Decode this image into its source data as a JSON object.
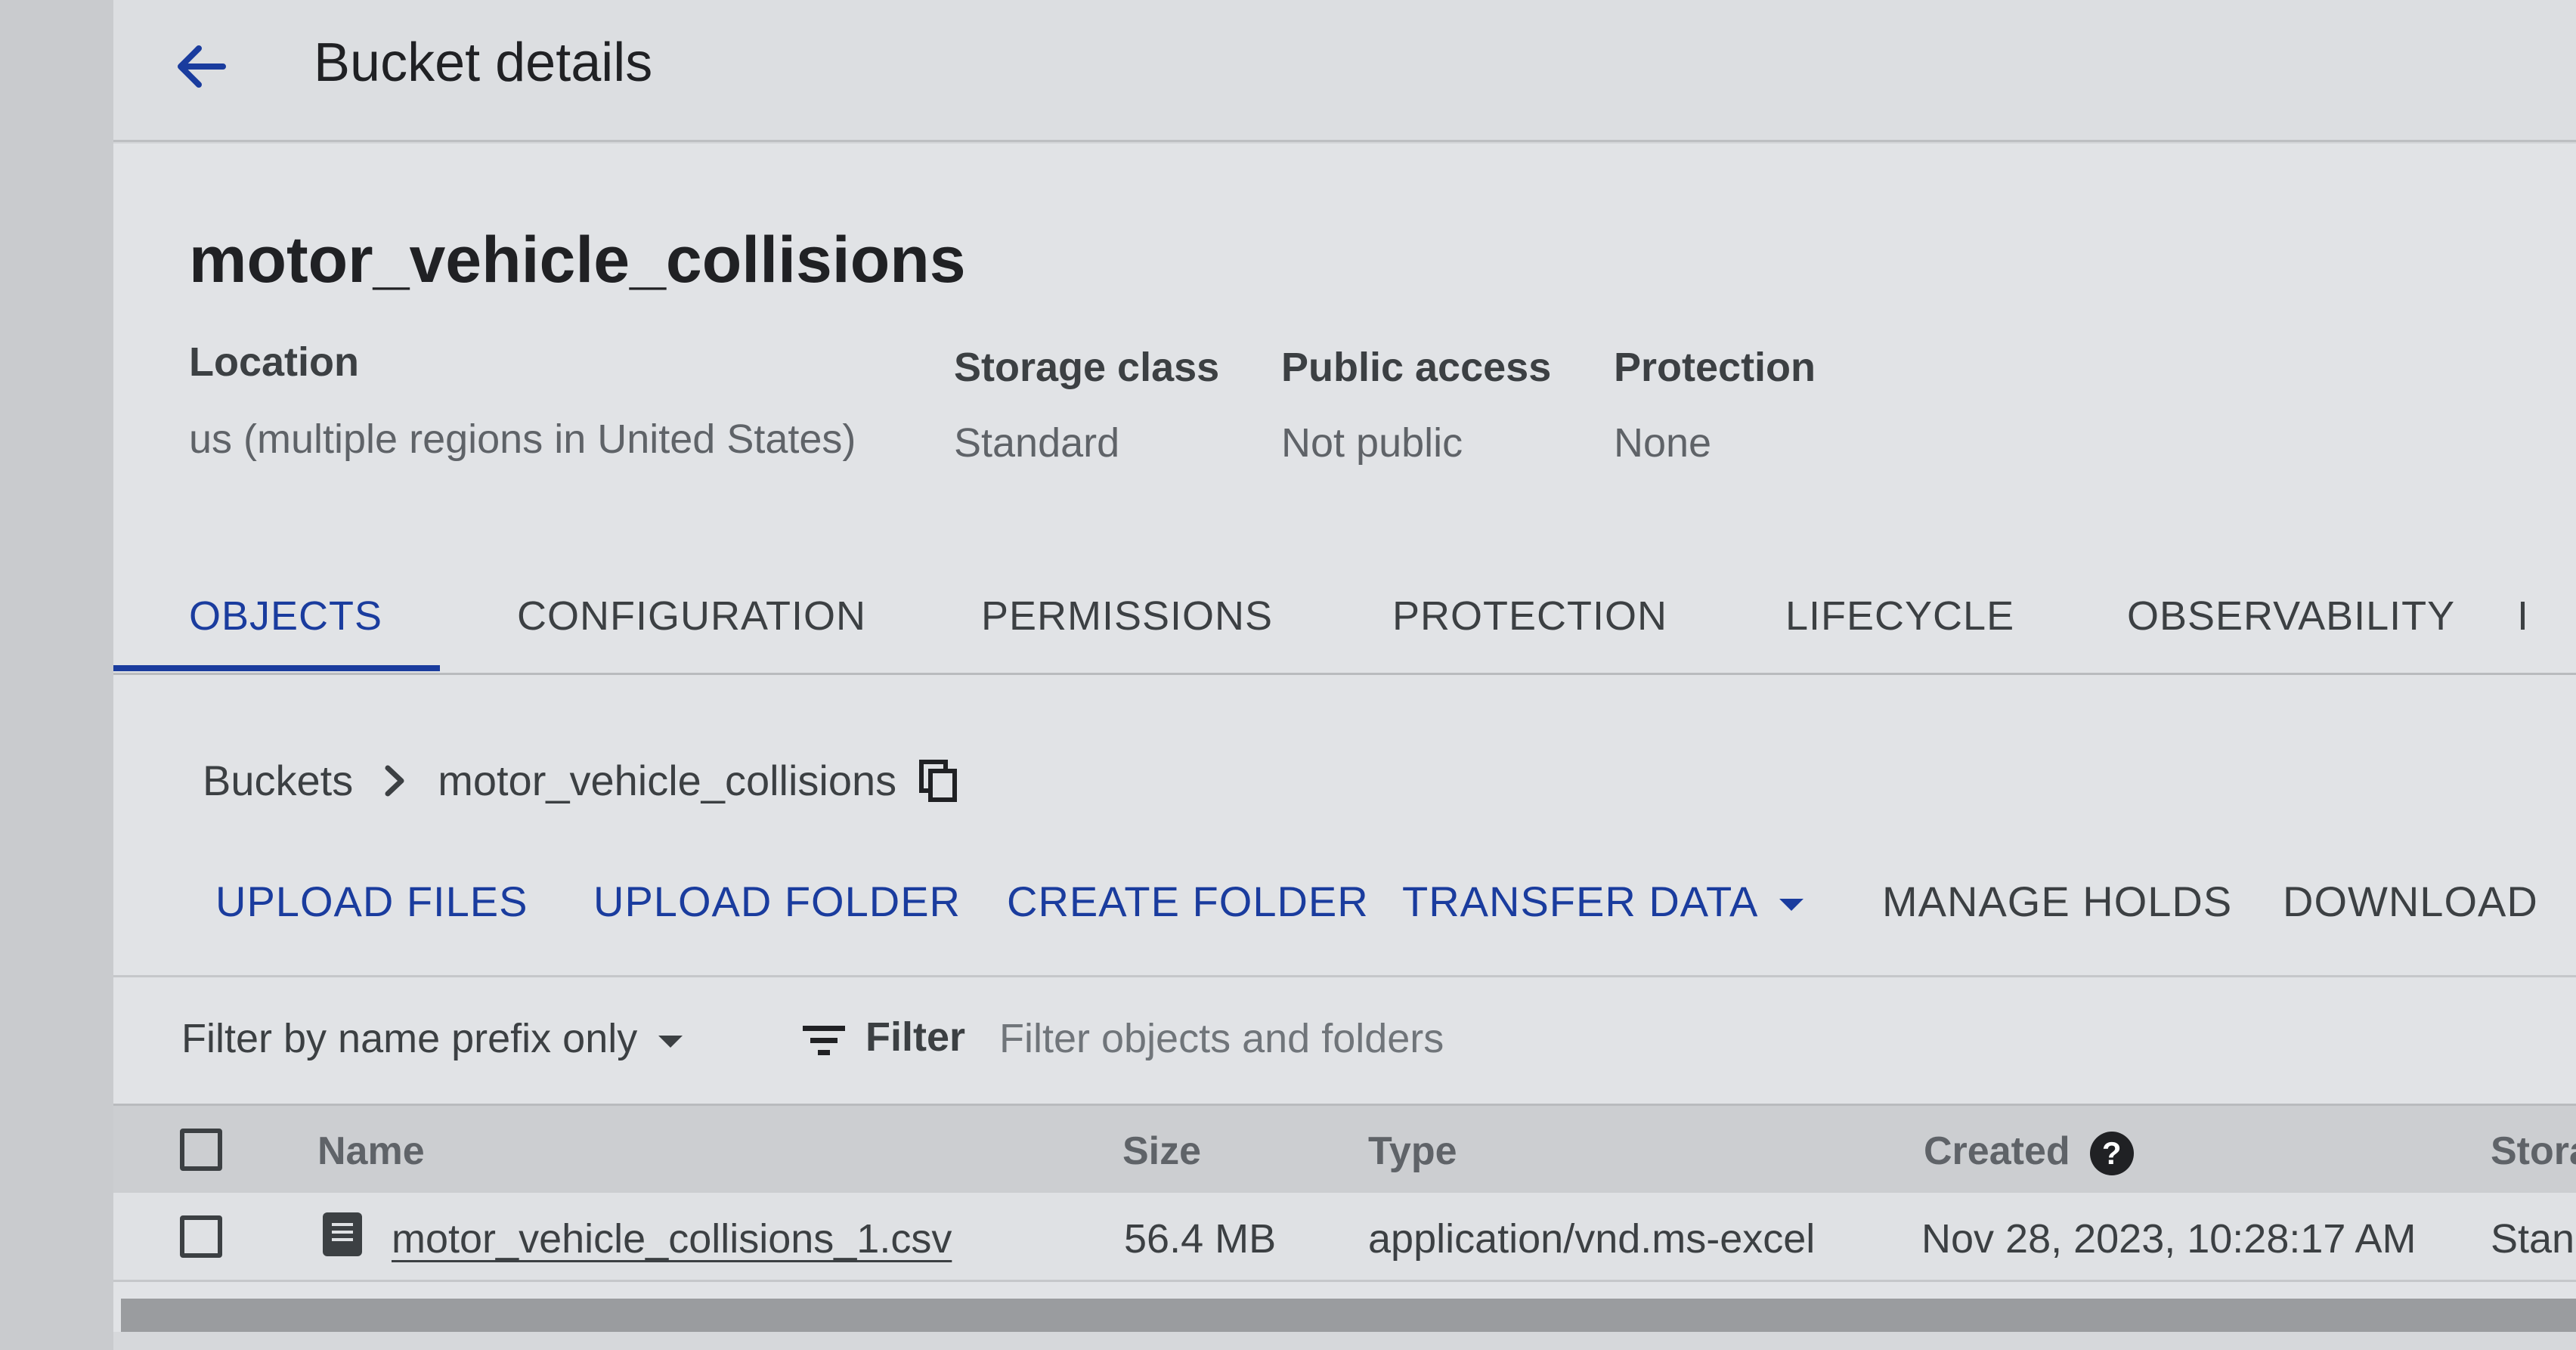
{
  "header": {
    "title": "Bucket details",
    "back_icon": "arrow-back-icon"
  },
  "bucket": {
    "name": "motor_vehicle_collisions",
    "meta": [
      {
        "label": "Location",
        "value": "us (multiple regions in United States)"
      },
      {
        "label": "Storage class",
        "value": "Standard"
      },
      {
        "label": "Public access",
        "value": "Not public"
      },
      {
        "label": "Protection",
        "value": "None"
      }
    ]
  },
  "tabs": [
    {
      "label": "OBJECTS",
      "active": true
    },
    {
      "label": "CONFIGURATION",
      "active": false
    },
    {
      "label": "PERMISSIONS",
      "active": false
    },
    {
      "label": "PROTECTION",
      "active": false
    },
    {
      "label": "LIFECYCLE",
      "active": false
    },
    {
      "label": "OBSERVABILITY",
      "active": false
    },
    {
      "label": "I",
      "active": false
    }
  ],
  "breadcrumb": {
    "root": "Buckets",
    "current": "motor_vehicle_collisions",
    "separator_icon": "chevron-right-icon",
    "copy_icon": "copy-icon"
  },
  "actions": [
    {
      "label": "UPLOAD FILES",
      "style": "primary"
    },
    {
      "label": "UPLOAD FOLDER",
      "style": "primary"
    },
    {
      "label": "CREATE FOLDER",
      "style": "primary"
    },
    {
      "label": "TRANSFER DATA",
      "style": "primary",
      "dropdown": true
    },
    {
      "label": "MANAGE HOLDS",
      "style": "secondary"
    },
    {
      "label": "DOWNLOAD",
      "style": "secondary"
    }
  ],
  "filter": {
    "mode_label": "Filter by name prefix only",
    "filter_label": "Filter",
    "placeholder": "Filter objects and folders",
    "filter_icon": "filter-list-icon"
  },
  "table": {
    "columns": [
      "Name",
      "Size",
      "Type",
      "Created",
      "Stora"
    ],
    "help_icon": "help-icon",
    "rows": [
      {
        "name": "motor_vehicle_collisions_1.csv",
        "size": "56.4 MB",
        "type": "application/vnd.ms-excel",
        "created": "Nov 28, 2023, 10:28:17 AM",
        "storage": "Stan",
        "icon": "file-document-icon"
      }
    ]
  },
  "colors": {
    "accent": "#1a3c9e",
    "text": "#202124",
    "secondary_text": "#3c4043"
  }
}
